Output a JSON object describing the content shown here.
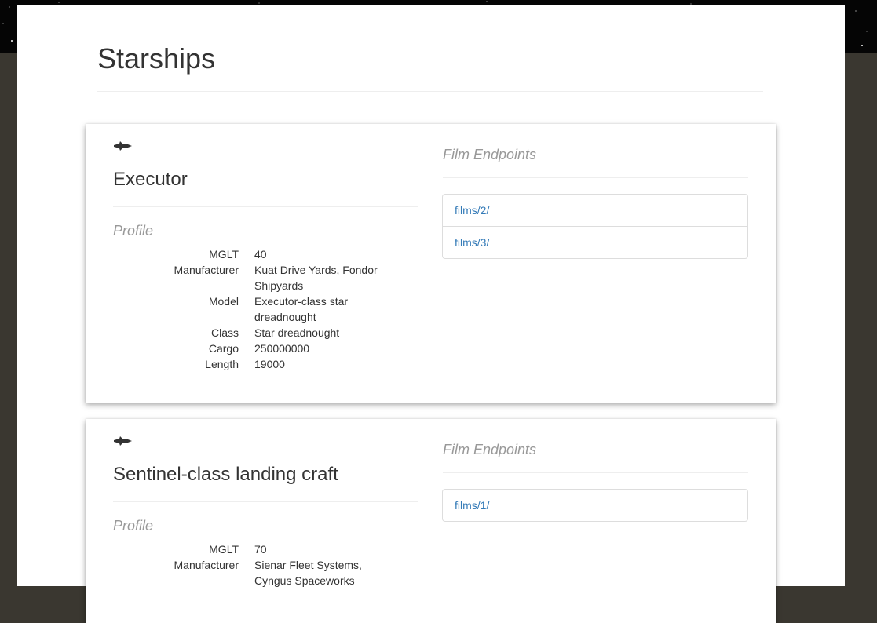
{
  "page": {
    "title": "Starships"
  },
  "starships": [
    {
      "name": "Executor",
      "icon": "starship-icon",
      "profile_heading": "Profile",
      "profile": [
        {
          "label": "MGLT",
          "value": "40"
        },
        {
          "label": "Manufacturer",
          "value": "Kuat Drive Yards, Fondor Shipyards"
        },
        {
          "label": "Model",
          "value": "Executor-class star dreadnought"
        },
        {
          "label": "Class",
          "value": "Star dreadnought"
        },
        {
          "label": "Cargo",
          "value": "250000000"
        },
        {
          "label": "Length",
          "value": "19000"
        }
      ],
      "films_heading": "Film Endpoints",
      "films": [
        "films/2/",
        "films/3/"
      ]
    },
    {
      "name": "Sentinel-class landing craft",
      "icon": "starship-icon",
      "profile_heading": "Profile",
      "profile": [
        {
          "label": "MGLT",
          "value": "70"
        },
        {
          "label": "Manufacturer",
          "value": "Sienar Fleet Systems, Cyngus Spaceworks"
        }
      ],
      "films_heading": "Film Endpoints",
      "films": [
        "films/1/"
      ]
    }
  ],
  "colors": {
    "link": "#337ab7",
    "muted": "#999999",
    "backdrop": "#3a3730"
  }
}
